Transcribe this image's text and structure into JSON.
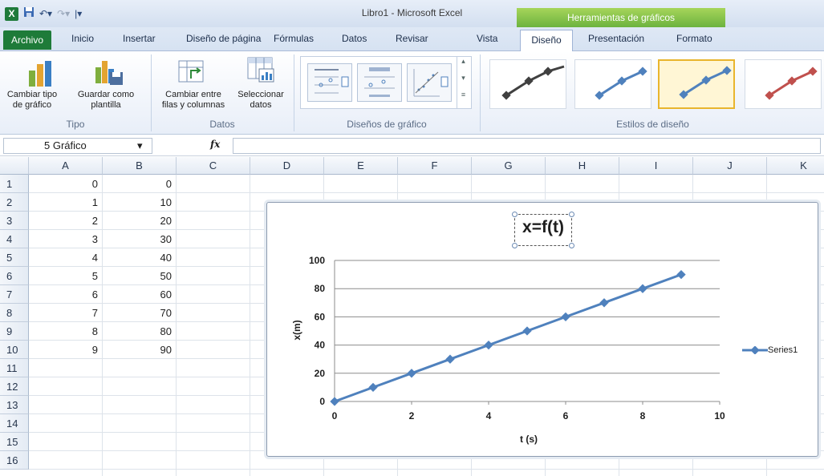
{
  "window": {
    "title": "Libro1  -  Microsoft Excel",
    "context_tab_group": "Herramientas de gráficos"
  },
  "tabs": {
    "file": "Archivo",
    "items": [
      "Inicio",
      "Insertar",
      "Diseño de página",
      "Fórmulas",
      "Datos",
      "Revisar",
      "Vista"
    ],
    "context": [
      "Diseño",
      "Presentación",
      "Formato"
    ],
    "active": "Diseño"
  },
  "ribbon": {
    "tipo": {
      "label": "Tipo",
      "change_type": "Cambiar tipo\nde gráfico",
      "save_template": "Guardar como\nplantilla"
    },
    "datos": {
      "label": "Datos",
      "switch_rows": "Cambiar entre\nfilas y columnas",
      "select_data": "Seleccionar\ndatos"
    },
    "layouts": {
      "label": "Diseños de gráfico"
    },
    "styles": {
      "label": "Estilos de diseño",
      "colors": [
        "#404040",
        "#4f81bd",
        "#4f81bd",
        "#c0504d"
      ]
    }
  },
  "formula_bar": {
    "name_box": "5 Gráfico",
    "fx": "fx",
    "value": ""
  },
  "sheet": {
    "columns": [
      "A",
      "B",
      "C",
      "D",
      "E",
      "F",
      "G",
      "H",
      "I",
      "J",
      "K"
    ],
    "rows": [
      "1",
      "2",
      "3",
      "4",
      "5",
      "6",
      "7",
      "8",
      "9",
      "10",
      "11",
      "12",
      "13",
      "14",
      "15",
      "16"
    ],
    "col_a": [
      "0",
      "1",
      "2",
      "3",
      "4",
      "5",
      "6",
      "7",
      "8",
      "9"
    ],
    "col_b": [
      "0",
      "10",
      "20",
      "30",
      "40",
      "50",
      "60",
      "70",
      "80",
      "90"
    ]
  },
  "chart_data": {
    "type": "line",
    "title": "x=f(t)",
    "xlabel": "t (s)",
    "ylabel": "x(m)",
    "x": [
      0,
      1,
      2,
      3,
      4,
      5,
      6,
      7,
      8,
      9
    ],
    "series": [
      {
        "name": "Series1",
        "values": [
          0,
          10,
          20,
          30,
          40,
          50,
          60,
          70,
          80,
          90
        ]
      }
    ],
    "xlim": [
      0,
      10
    ],
    "ylim": [
      0,
      100
    ],
    "xticks": [
      "0",
      "2",
      "4",
      "6",
      "8",
      "10"
    ],
    "yticks": [
      "0",
      "20",
      "40",
      "60",
      "80",
      "100"
    ],
    "grid": "horizontal",
    "legend": "right",
    "color": "#4f81bd"
  }
}
